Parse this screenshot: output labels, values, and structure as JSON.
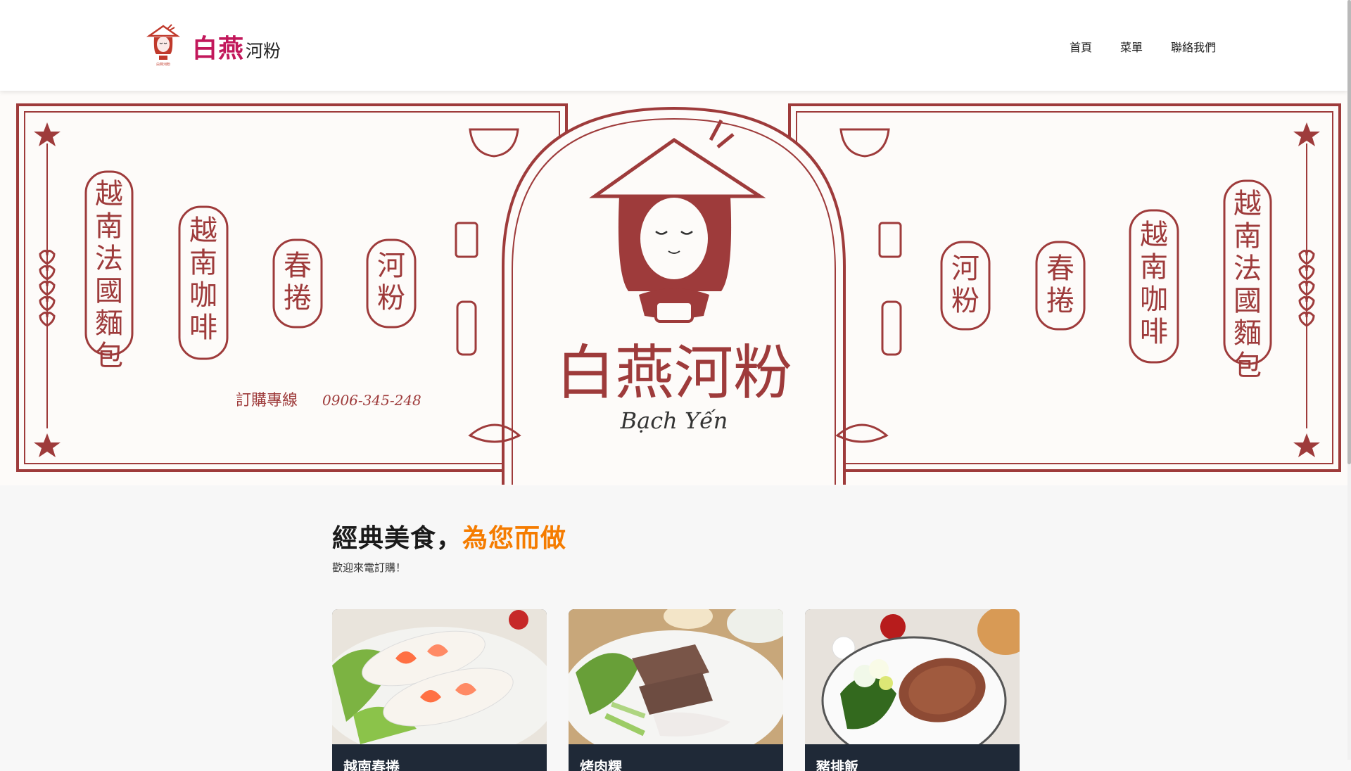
{
  "header": {
    "brand_main": "白燕",
    "brand_sub": "河粉",
    "logo_icon": "bach-yen-logo-icon",
    "nav": [
      {
        "label": "首頁"
      },
      {
        "label": "菜單"
      },
      {
        "label": "聯絡我們"
      }
    ]
  },
  "banner": {
    "name_cn": "白燕河粉",
    "name_vn": "Bạch Yến",
    "phone_label": "訂購專線",
    "phone": "0906-345-248",
    "items_left": [
      "越南法國麵包",
      "越南咖啡",
      "春捲",
      "河粉"
    ],
    "items_right": [
      "河粉",
      "春捲",
      "越南咖啡",
      "越南法國麵包"
    ],
    "accent_color": "#9e3b3b"
  },
  "section": {
    "headline_dark": "經典美食，",
    "headline_accent": "為您而做",
    "subline": "歡迎來電訂購！",
    "accent_color": "#f57c00",
    "cards": [
      {
        "image": "spring-rolls-photo",
        "title": "越南春捲"
      },
      {
        "image": "grilled-pork-vermicelli-photo",
        "title": "烤肉粿"
      },
      {
        "image": "pork-chop-rice-photo",
        "title": "豬排飯"
      }
    ]
  }
}
